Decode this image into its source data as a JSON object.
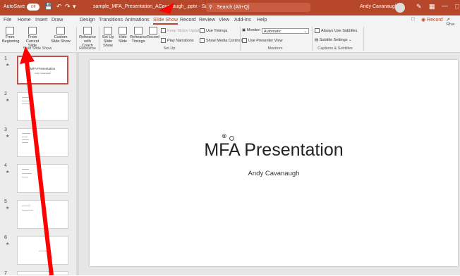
{
  "titlebar": {
    "autosave_label": "AutoSave",
    "autosave_state": "Off",
    "filename": "sample_MFA_Presentation_ACavanaugh_.pptx - Saved to this PC",
    "search_placeholder": "Search (Alt+Q)",
    "user_name": "Andy Cavanaugh",
    "accent_color": "#b7472a"
  },
  "tabs": [
    "File",
    "Home",
    "Insert",
    "Draw",
    "Design",
    "Transitions",
    "Animations",
    "Slide Show",
    "Record",
    "Review",
    "View",
    "Add-ins",
    "Help"
  ],
  "active_tab": "Slide Show",
  "tab_right": {
    "record_label": "Record",
    "share_label": "Sha"
  },
  "ribbon": {
    "start": {
      "from_beginning": "From Beginning",
      "from_current": "From Current Slide",
      "custom_show": "Custom Slide Show",
      "label": "Start Slide Show"
    },
    "rehearse": {
      "with_coach": "Rehearse with Coach",
      "label": "Rehearse"
    },
    "setup": {
      "set_up": "Set Up Slide Show",
      "hide": "Hide Slide",
      "rehearse_timings": "Rehearse Timings",
      "record": "Record",
      "keep_active": "Keep Slides Updated",
      "use_timings": "Use Timings",
      "play_narrations": "Play Narrations",
      "show_media": "Show Media Controls",
      "label": "Set Up"
    },
    "monitors": {
      "monitor_label": "Monitor:",
      "monitor_value": "Automatic",
      "presenter_view": "Use Presenter View",
      "label": "Monitors"
    },
    "captions": {
      "always_subtitles": "Always Use Subtitles",
      "subtitle_settings": "Subtitle Settings",
      "label": "Captions & Subtitles"
    }
  },
  "thumbnails": [
    {
      "num": "1",
      "title": "MFA Presentation",
      "sub": "Andy Cavanaugh"
    },
    {
      "num": "2"
    },
    {
      "num": "3"
    },
    {
      "num": "4"
    },
    {
      "num": "5"
    },
    {
      "num": "6"
    },
    {
      "num": "7"
    }
  ],
  "slide": {
    "title": "MFA Presentation",
    "subtitle": "Andy Cavanaugh"
  }
}
